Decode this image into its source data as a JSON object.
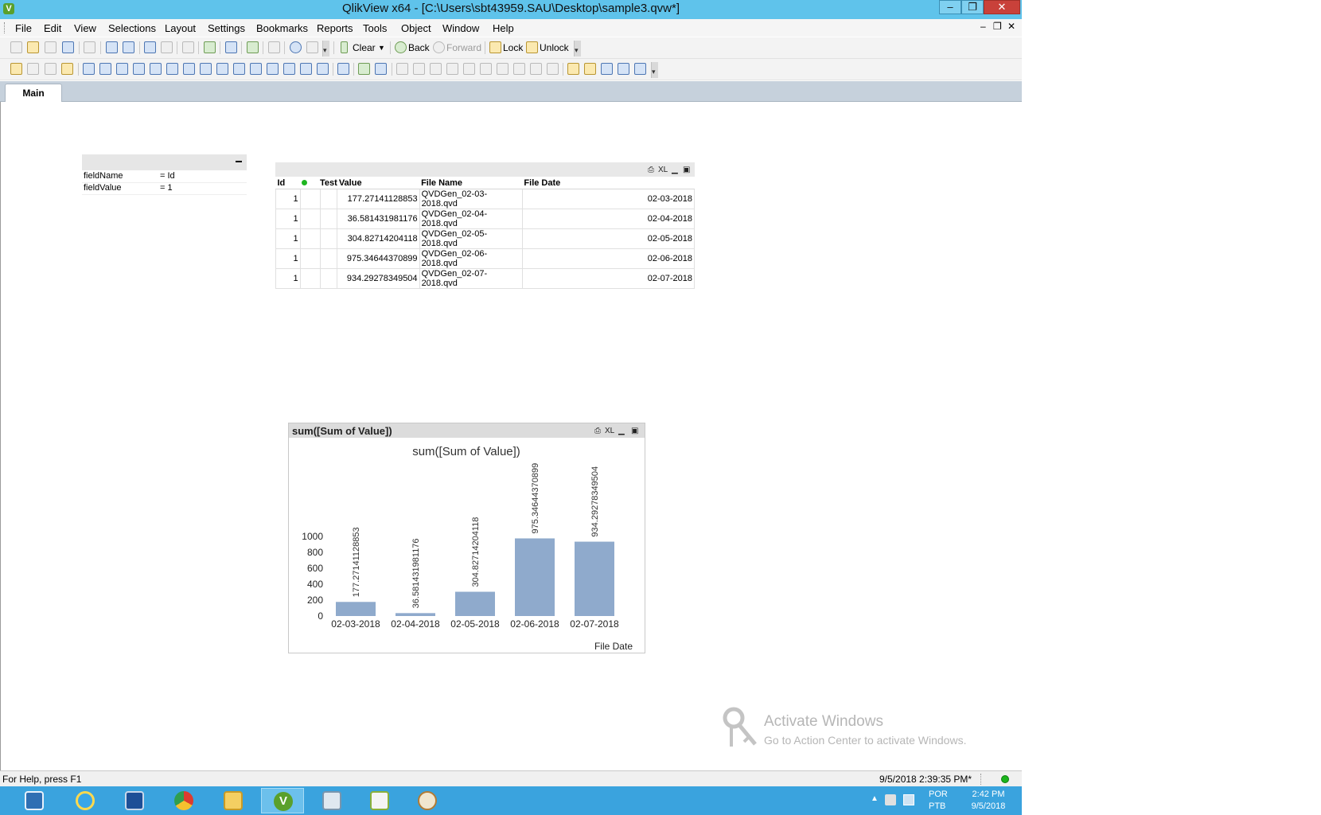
{
  "window": {
    "title": "QlikView x64 - [C:\\Users\\sbt43959.SAU\\Desktop\\sample3.qvw*]",
    "app_icon_letter": "V",
    "min_glyph": "‒",
    "max_glyph": "❐",
    "close_glyph": "✕",
    "mdi_min": "‒",
    "mdi_restore": "❐",
    "mdi_close": "✕"
  },
  "menu": [
    "File",
    "Edit",
    "View",
    "Selections",
    "Layout",
    "Settings",
    "Bookmarks",
    "Reports",
    "Tools",
    "Object",
    "Window",
    "Help"
  ],
  "toolbar": {
    "clear": "Clear",
    "back": "Back",
    "forward": "Forward",
    "lock": "Lock",
    "unlock": "Unlock"
  },
  "tabs": [
    {
      "label": "Main"
    }
  ],
  "current_selections": {
    "rows": [
      {
        "field": "fieldName",
        "value": "= Id"
      },
      {
        "field": "fieldValue",
        "value": "= 1"
      }
    ]
  },
  "table_box": {
    "caption_icons": [
      "print-icon",
      "xl-icon",
      "minimize-icon",
      "maximize-icon"
    ],
    "xl_label": "XL",
    "columns": [
      "Id",
      "Test",
      "Value",
      "File Name",
      "File Date"
    ],
    "rows": [
      {
        "id": "1",
        "test": "",
        "value": "177.27141128853",
        "file_name": "QVDGen_02-03-2018.qvd",
        "file_date": "02-03-2018"
      },
      {
        "id": "1",
        "test": "",
        "value": "36.581431981176",
        "file_name": "QVDGen_02-04-2018.qvd",
        "file_date": "02-04-2018"
      },
      {
        "id": "1",
        "test": "",
        "value": "304.82714204118",
        "file_name": "QVDGen_02-05-2018.qvd",
        "file_date": "02-05-2018"
      },
      {
        "id": "1",
        "test": "",
        "value": "975.34644370899",
        "file_name": "QVDGen_02-06-2018.qvd",
        "file_date": "02-06-2018"
      },
      {
        "id": "1",
        "test": "",
        "value": "934.29278349504",
        "file_name": "QVDGen_02-07-2018.qvd",
        "file_date": "02-07-2018"
      }
    ]
  },
  "chart_box": {
    "caption": "sum([Sum of Value])",
    "xl_label": "XL"
  },
  "chart_data": {
    "type": "bar",
    "title": "sum([Sum of Value])",
    "xlabel": "File Date",
    "ylabel": "",
    "categories": [
      "02-03-2018",
      "02-04-2018",
      "02-05-2018",
      "02-06-2018",
      "02-07-2018"
    ],
    "values": [
      177.27141128853,
      36.581431981176,
      304.82714204118,
      975.34644370899,
      934.29278349504
    ],
    "value_labels": [
      "177.27141128853",
      "36.581431981176",
      "304.82714204118",
      "975.34644370899",
      "934.29278349504"
    ],
    "yticks": [
      0,
      200,
      400,
      600,
      800,
      1000
    ],
    "ylim": [
      0,
      1000
    ],
    "bar_color": "#8faacc",
    "grid": false,
    "legend": "none"
  },
  "watermark": {
    "title": "Activate Windows",
    "subtitle": "Go to Action Center to activate Windows."
  },
  "statusbar": {
    "help": "For Help, press F1",
    "timestamp": "9/5/2018 2:39:35 PM*"
  },
  "taskbar": {
    "apps": [
      "server-manager-icon",
      "internet-explorer-icon",
      "outlook-icon",
      "chrome-icon",
      "file-explorer-icon",
      "qlikview-icon",
      "task-manager-icon",
      "notepad-chart-icon",
      "paint-icon"
    ],
    "lang_top": "POR",
    "lang_bottom": "PTB",
    "clock_time": "2:42 PM",
    "clock_date": "9/5/2018"
  }
}
